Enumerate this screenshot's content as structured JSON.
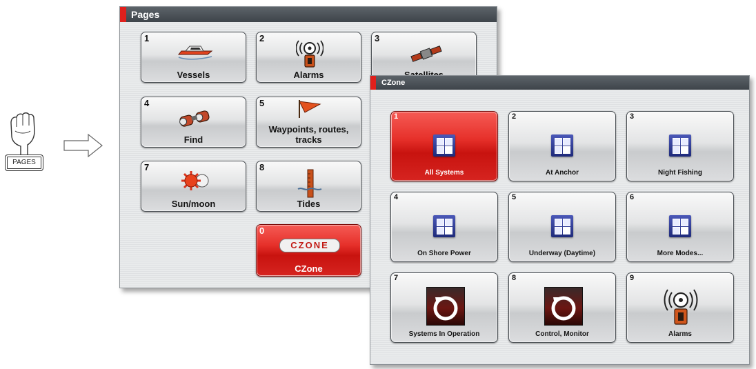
{
  "pages_key": {
    "label": "PAGES"
  },
  "pages_window": {
    "title": "Pages",
    "tiles": [
      {
        "number": "1",
        "label": "Vessels",
        "icon": "boat-icon"
      },
      {
        "number": "2",
        "label": "Alarms",
        "icon": "alarm-icon"
      },
      {
        "number": "3",
        "label": "Satellites",
        "icon": "satellite-icon"
      },
      {
        "number": "4",
        "label": "Find",
        "icon": "binoculars-icon"
      },
      {
        "number": "5",
        "label": "Waypoints, routes, tracks",
        "icon": "flag-icon"
      },
      {
        "number": "7",
        "label": "Sun/moon",
        "icon": "sun-moon-icon"
      },
      {
        "number": "8",
        "label": "Tides",
        "icon": "tide-icon"
      },
      {
        "number": "0",
        "label": "CZone",
        "icon": "czone-logo-icon",
        "logo_text": "CZONE"
      }
    ]
  },
  "czone_window": {
    "title": "CZone",
    "tiles": [
      {
        "number": "1",
        "label": "All Systems",
        "icon": "mode-icon"
      },
      {
        "number": "2",
        "label": "At Anchor",
        "icon": "mode-icon"
      },
      {
        "number": "3",
        "label": "Night Fishing",
        "icon": "mode-icon"
      },
      {
        "number": "4",
        "label": "On Shore Power",
        "icon": "mode-icon"
      },
      {
        "number": "5",
        "label": "Underway (Daytime)",
        "icon": "mode-icon"
      },
      {
        "number": "6",
        "label": "More Modes...",
        "icon": "mode-icon"
      },
      {
        "number": "7",
        "label": "Systems In Operation",
        "icon": "czone-dial-icon"
      },
      {
        "number": "8",
        "label": "Control, Monitor",
        "icon": "czone-dial-icon"
      },
      {
        "number": "9",
        "label": "Alarms",
        "icon": "alarm-icon"
      }
    ]
  },
  "colors": {
    "title_bar": "#4a5157",
    "accent_red": "#e0201c",
    "selected_tile": "#d9221d",
    "mode_icon_blue": "#2b3a99"
  }
}
